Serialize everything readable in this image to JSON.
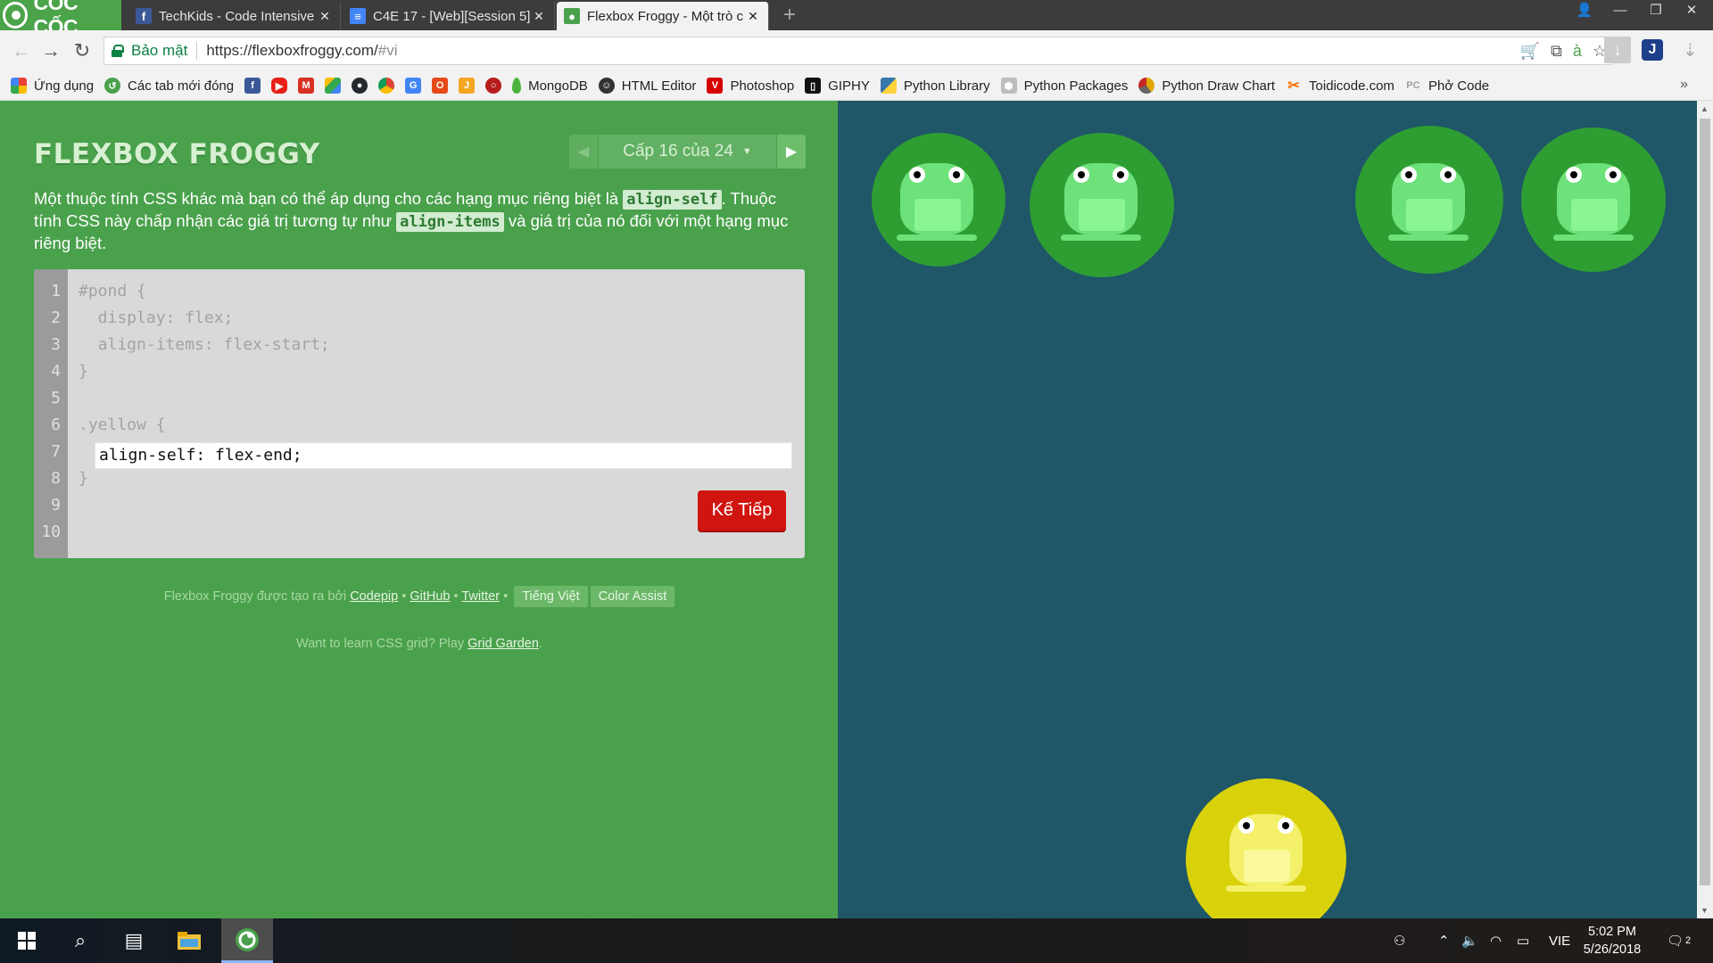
{
  "browser": {
    "brand": "CỐC CỐC",
    "tabs": [
      {
        "title": "TechKids - Code Intensive",
        "icon": "facebook-icon",
        "color": "#3b5998"
      },
      {
        "title": "C4E 17 - [Web][Session 5]",
        "icon": "docs-icon",
        "color": "#4285f4"
      },
      {
        "title": "Flexbox Froggy - Một trò c",
        "icon": "frog-icon",
        "color": "#4aa14c"
      }
    ],
    "address": {
      "secure_label": "Bảo mật",
      "url": "https://flexboxfroggy.com/",
      "url_hash": "#vi"
    },
    "bookmarks": [
      {
        "label": "Ứng dụng",
        "icon": "apps-icon",
        "color": "#e94235"
      },
      {
        "label": "Các tab mới đóng",
        "icon": "recent-tabs-icon",
        "color": "#4aa14c"
      },
      {
        "label": "",
        "icon": "facebook-icon",
        "color": "#3b5998"
      },
      {
        "label": "",
        "icon": "youtube-icon",
        "color": "#e62117"
      },
      {
        "label": "",
        "icon": "gmail-icon",
        "color": "#d93025"
      },
      {
        "label": "",
        "icon": "drive-icon",
        "color": "#1fa463"
      },
      {
        "label": "",
        "icon": "github-icon",
        "color": "#24292e"
      },
      {
        "label": "",
        "icon": "chrome-icon",
        "color": "#db4437"
      },
      {
        "label": "",
        "icon": "translate-icon",
        "color": "#4285f4"
      },
      {
        "label": "",
        "icon": "office-icon",
        "color": "#e64a19"
      },
      {
        "label": "",
        "icon": "jira-icon",
        "color": "#f4a623"
      },
      {
        "label": "",
        "icon": "search-red-icon",
        "color": "#b71c1c"
      },
      {
        "label": "MongoDB",
        "icon": "mongodb-icon",
        "color": "#4db33d"
      },
      {
        "label": "HTML Editor",
        "icon": "html-editor-icon",
        "color": "#333333"
      },
      {
        "label": "Photoshop",
        "icon": "photoshop-icon",
        "color": "#d50000"
      },
      {
        "label": "GIPHY",
        "icon": "giphy-icon",
        "color": "#121212"
      },
      {
        "label": "Python Library",
        "icon": "python-icon",
        "color": "#3776ab"
      },
      {
        "label": "Python Packages",
        "icon": "package-icon",
        "color": "#9e9e9e"
      },
      {
        "label": "Python Draw Chart",
        "icon": "chart-icon",
        "color": "#e0a800"
      },
      {
        "label": "Toidicode.com",
        "icon": "toidicode-icon",
        "color": "#ff6f00"
      },
      {
        "label": "Phở Code",
        "icon": "phocode-icon",
        "color": "#9e9e9e"
      }
    ]
  },
  "game": {
    "logo": "FLEXBOX FROGGY",
    "level_label": "Cấp 16 của 24",
    "instructions": {
      "p1": "Một thuộc tính CSS khác mà bạn có thể áp dụng cho các hạng mục riêng biệt là ",
      "code1": "align-self",
      "p2": ". Thuộc tính CSS này chấp nhận các giá trị tương tự như ",
      "code2": "align-items",
      "p3": " và giá trị của nó đối với một hạng mục riêng biệt."
    },
    "editor": {
      "line_numbers": [
        "1",
        "2",
        "3",
        "4",
        "5",
        "6",
        "7",
        "8",
        "9",
        "10"
      ],
      "lines": [
        "#pond {",
        "  display: flex;",
        "  align-items: flex-start;",
        "}",
        "",
        ".yellow {",
        "",
        "}",
        "",
        ""
      ],
      "input_value": "align-self: flex-end;"
    },
    "next_button": "Kế Tiếp",
    "credits": {
      "prefix": "Flexbox Froggy được tạo ra bởi ",
      "codepip": "Codepip",
      "github": "GitHub",
      "twitter": "Twitter",
      "sep": " • ",
      "language": "Tiếng Việt",
      "color_assist": "Color Assist"
    },
    "learn": {
      "prefix": "Want to learn CSS grid? Play ",
      "link": "Grid Garden",
      "suffix": "."
    },
    "colors": {
      "green_frog": "#6ee27a",
      "green_pad": "#2e9e33",
      "yellow_frog": "#f4f06a",
      "yellow_pad": "#d9d20a",
      "pond": "#1f5668"
    }
  },
  "taskbar": {
    "language": "VIE",
    "time": "5:02 PM",
    "date": "5/26/2018",
    "notifications": "2"
  }
}
